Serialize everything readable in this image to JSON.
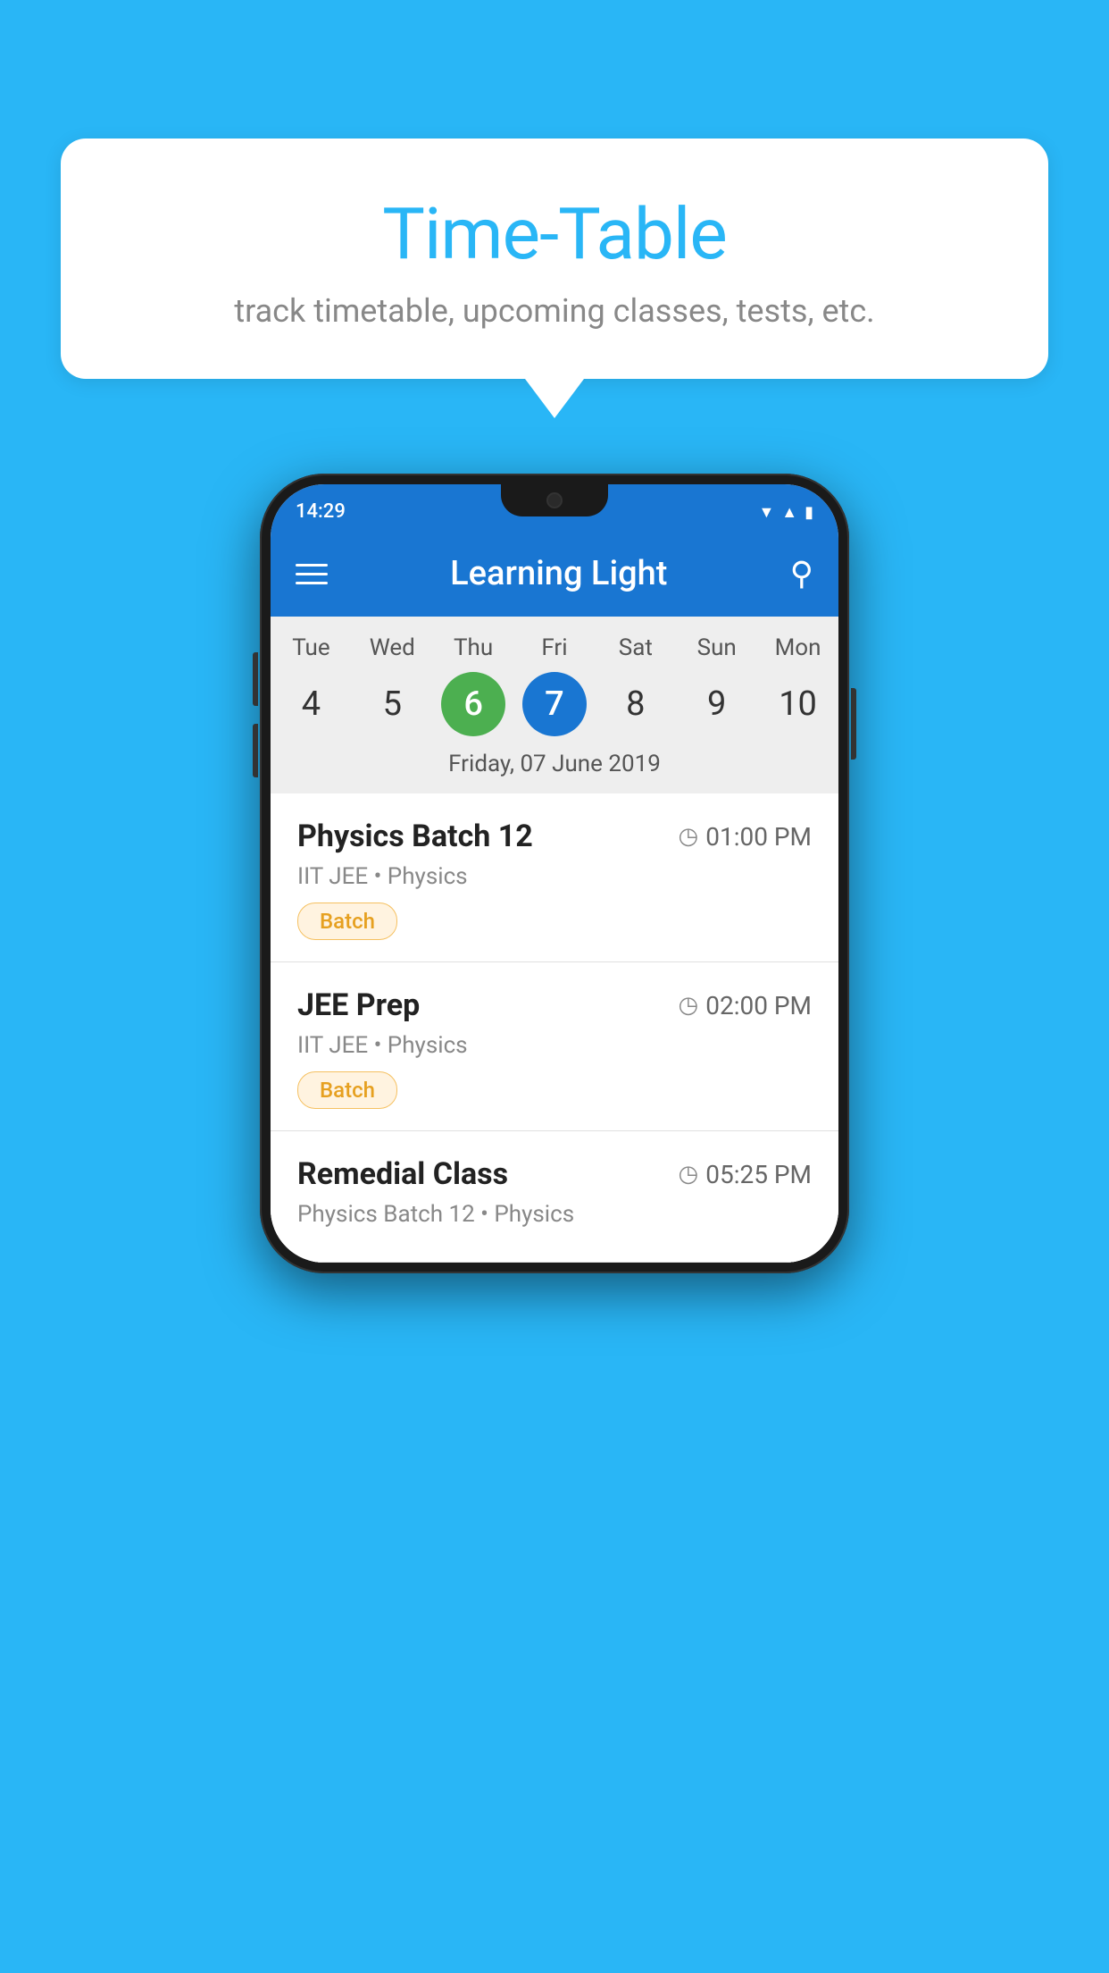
{
  "background_color": "#29B6F6",
  "bubble": {
    "title": "Time-Table",
    "subtitle": "track timetable, upcoming classes, tests, etc."
  },
  "phone": {
    "status_bar": {
      "time": "14:29",
      "icons": [
        "wifi",
        "signal",
        "battery"
      ]
    },
    "app_bar": {
      "title": "Learning Light",
      "menu_icon": "hamburger",
      "search_icon": "search"
    },
    "calendar": {
      "days": [
        {
          "label": "Tue",
          "number": "4"
        },
        {
          "label": "Wed",
          "number": "5"
        },
        {
          "label": "Thu",
          "number": "6",
          "state": "today"
        },
        {
          "label": "Fri",
          "number": "7",
          "state": "selected"
        },
        {
          "label": "Sat",
          "number": "8"
        },
        {
          "label": "Sun",
          "number": "9"
        },
        {
          "label": "Mon",
          "number": "10"
        }
      ],
      "selected_date_label": "Friday, 07 June 2019"
    },
    "schedule": [
      {
        "title": "Physics Batch 12",
        "time": "01:00 PM",
        "subtitle": "IIT JEE • Physics",
        "tag": "Batch"
      },
      {
        "title": "JEE Prep",
        "time": "02:00 PM",
        "subtitle": "IIT JEE • Physics",
        "tag": "Batch"
      },
      {
        "title": "Remedial Class",
        "time": "05:25 PM",
        "subtitle": "Physics Batch 12 • Physics",
        "tag": ""
      }
    ]
  }
}
